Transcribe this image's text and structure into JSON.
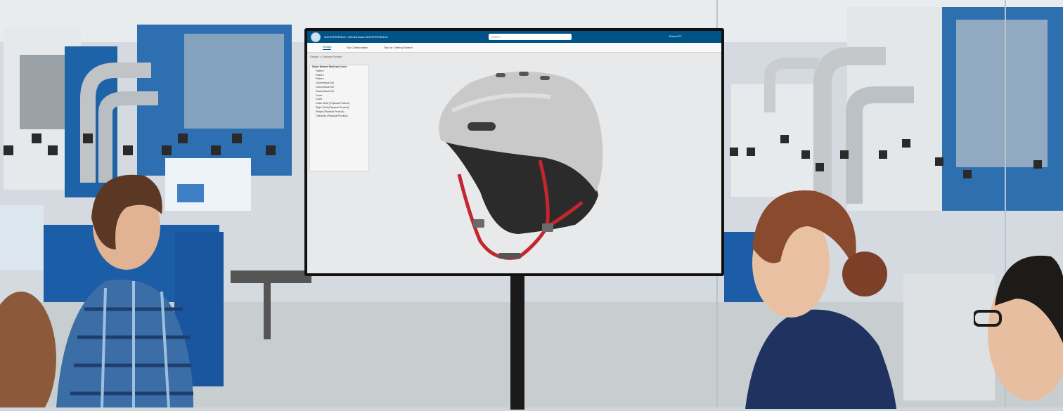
{
  "screen": {
    "brand": "3DEXPERIENCE | 3DDashboard 3DEXPERIENCE",
    "search_placeholder": "Search",
    "user": "Robert E?",
    "tabs": [
      {
        "label": "Design"
      },
      {
        "label": "My Collaboration"
      },
      {
        "label": "Tips for Getting Started"
      }
    ],
    "breadcrumb": "Design > Concept Design",
    "tree": [
      "Skate Helmet Shell and Cove",
      "Pattern",
      "Pattern",
      "Pattern",
      "Geometrical Set",
      "Geometrical Set",
      "Geometrical Set",
      "Cover",
      "Cover",
      "Outer Shell (Physical Product)",
      "Rigid Shell (Physical Product)",
      "Straps (Physical Product)",
      "Chinstrap (Physical Product)"
    ]
  },
  "colors": {
    "topbar": "#005386",
    "helmet_shell": "#c9c9c9",
    "helmet_liner": "#2b2b2b",
    "strap": "#c4262e"
  }
}
